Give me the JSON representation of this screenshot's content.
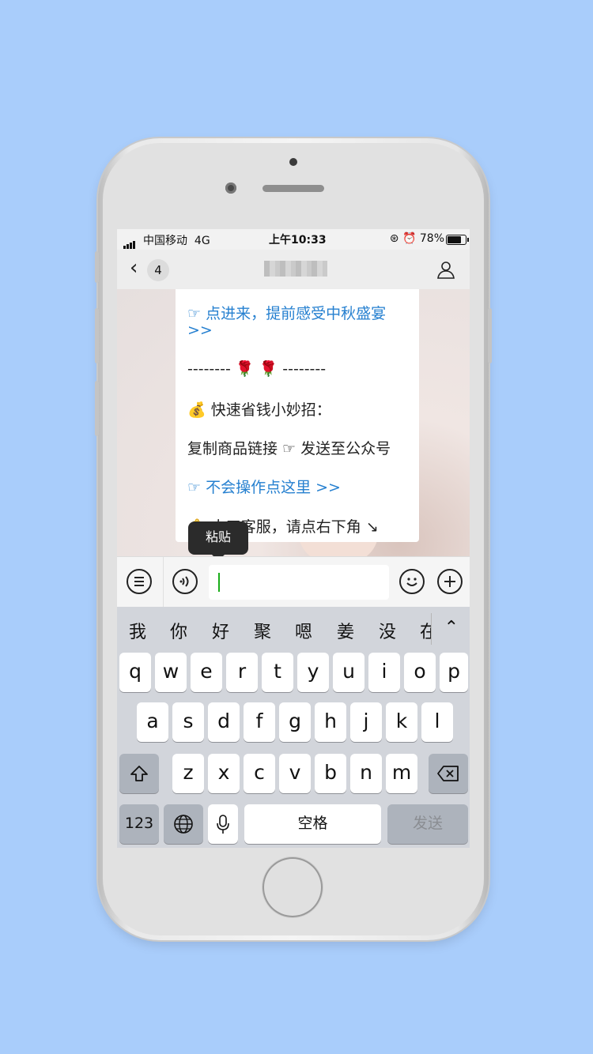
{
  "status": {
    "carrier": "中国移动",
    "network": "4G",
    "time": "上午10:33",
    "battery": "78%",
    "battery_level": 0.78
  },
  "nav": {
    "back_count": "4"
  },
  "messages": [
    {
      "text": "☞ 点进来，提前感受中秋盛宴",
      "link": true
    },
    {
      "text": ">>",
      "link": true
    },
    {
      "text": "-------- 🌹 🌹 --------",
      "link": false
    },
    {
      "text": "💰 快速省钱小妙招：",
      "link": false
    },
    {
      "text": "复制商品链接 ☞ 发送至公众号",
      "link": false
    },
    {
      "text": "☞ 不会操作点这里 >>",
      "link": true
    },
    {
      "text": "🔔 人工客服，请点右下角 ↘",
      "link": false
    }
  ],
  "tooltip": "粘贴",
  "input": {
    "value": ""
  },
  "candidates": [
    "我",
    "你",
    "好",
    "聚",
    "嗯",
    "姜",
    "没",
    "在"
  ],
  "keyboard": {
    "row1": [
      "q",
      "w",
      "e",
      "r",
      "t",
      "y",
      "u",
      "i",
      "o",
      "p"
    ],
    "row2": [
      "a",
      "s",
      "d",
      "f",
      "g",
      "h",
      "j",
      "k",
      "l"
    ],
    "row3": [
      "z",
      "x",
      "c",
      "v",
      "b",
      "n",
      "m"
    ],
    "num_key": "123",
    "space": "空格",
    "send": "发送"
  },
  "colors": {
    "background": "#a9cdfb",
    "link": "#2680d0",
    "caret": "#1aad19"
  }
}
